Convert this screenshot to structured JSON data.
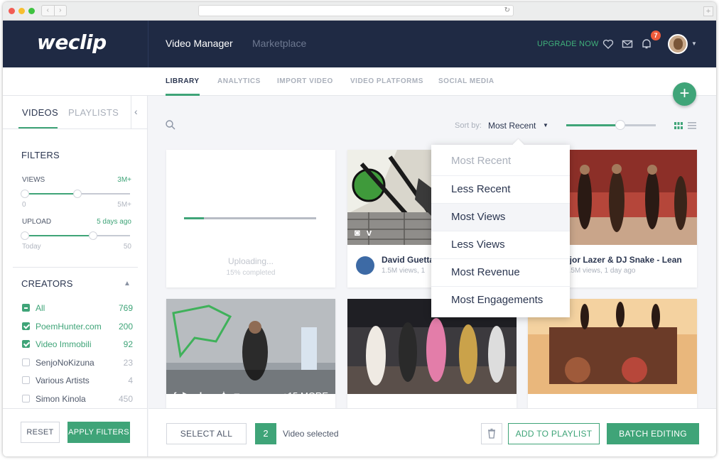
{
  "app": {
    "logo": "weclip",
    "nav": [
      "Video Manager",
      "Marketplace"
    ],
    "upgrade_label": "UPGRADE NOW",
    "notification_count": "7"
  },
  "subnav": {
    "tabs": [
      "LIBRARY",
      "ANALYTICS",
      "IMPORT VIDEO",
      "VIDEO PLATFORMS",
      "SOCIAL MEDIA"
    ],
    "active": "LIBRARY"
  },
  "sidebar": {
    "tabs": [
      "VIDEOS",
      "PLAYLISTS"
    ],
    "filters_title": "FILTERS",
    "views": {
      "label": "VIEWS",
      "value": "3M+",
      "min": "0",
      "max": "5M+",
      "range": [
        0,
        0.5
      ]
    },
    "upload": {
      "label": "UPLOAD",
      "value": "5 days ago",
      "min": "Today",
      "max": "50",
      "range": [
        0,
        0.65
      ]
    },
    "creators_title": "CREATORS",
    "creators": [
      {
        "name": "All",
        "count": "769",
        "state": "partial"
      },
      {
        "name": "PoemHunter.com",
        "count": "200",
        "state": "checked"
      },
      {
        "name": "Video Immobili",
        "count": "92",
        "state": "checked"
      },
      {
        "name": "SenjoNoKizuna",
        "count": "23",
        "state": "unchecked"
      },
      {
        "name": "Various Artists",
        "count": "4",
        "state": "unchecked"
      },
      {
        "name": "Simon Kinola",
        "count": "450",
        "state": "unchecked"
      }
    ],
    "reset_label": "RESET",
    "apply_label": "APPLY FILTERS"
  },
  "toolbar": {
    "sort_label": "Sort by:",
    "sort_value": "Most Recent",
    "zoom": 0.6
  },
  "sort_options": [
    "Most Recent",
    "Less Recent",
    "Most Views",
    "Less Views",
    "Most Revenue",
    "Most Engagements"
  ],
  "cards": {
    "uploading": {
      "status": "Uploading...",
      "progress_text": "15% completed",
      "progress": 0.15
    },
    "david": {
      "title": "David Guetta",
      "sub": "1.5M views, 1"
    },
    "majorlazer": {
      "title": "ajor Lazer & DJ Snake - Lean",
      "sub": "1.5M views, 1 day ago"
    },
    "dance": {
      "more_label": "+15 MORE"
    }
  },
  "footer": {
    "select_all_label": "SELECT ALL",
    "selected_count": "2",
    "selected_label": "Video selected",
    "add_playlist_label": "ADD TO PLAYLIST",
    "batch_label": "BATCH EDITING"
  },
  "colors": {
    "accent": "#3fa478",
    "nav_bg": "#1f2a44",
    "badge": "#ef5b3b"
  }
}
